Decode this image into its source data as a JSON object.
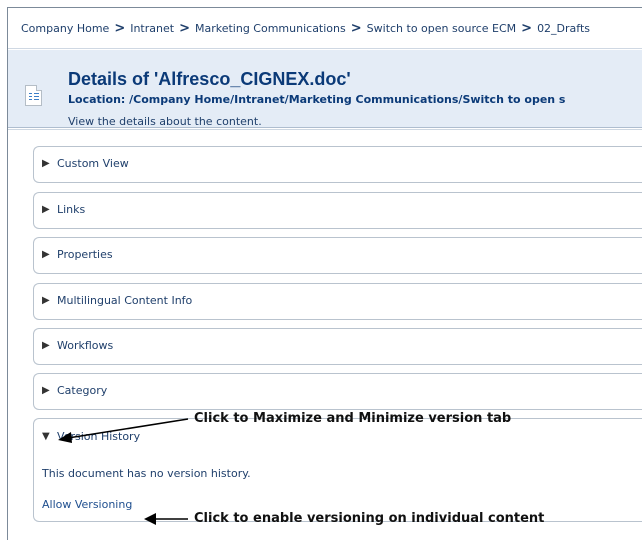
{
  "breadcrumb": {
    "items": [
      "Company Home",
      "Intranet",
      "Marketing Communications",
      "Switch to open source ECM",
      "02_Drafts"
    ],
    "separator": ">"
  },
  "header": {
    "icon": "document-icon",
    "title": "Details of 'Alfresco_CIGNEX.doc'",
    "location": "Location: /Company Home/Intranet/Marketing Communications/Switch to open s",
    "subtitle": "View the details about the content."
  },
  "panels": [
    {
      "label": "Custom View",
      "expanded": false
    },
    {
      "label": "Links",
      "expanded": false
    },
    {
      "label": "Properties",
      "expanded": false
    },
    {
      "label": "Multilingual Content Info",
      "expanded": false
    },
    {
      "label": "Workflows",
      "expanded": false
    },
    {
      "label": "Category",
      "expanded": false
    },
    {
      "label": "Version History",
      "expanded": true
    }
  ],
  "version_history": {
    "message": "This document has no version history.",
    "allow_link": "Allow Versioning"
  },
  "annotations": {
    "toggle": "Click to Maximize and Minimize version tab",
    "enable": "Click to enable versioning on individual content"
  },
  "icons": {
    "collapsed": "▶",
    "expanded": "▼"
  }
}
